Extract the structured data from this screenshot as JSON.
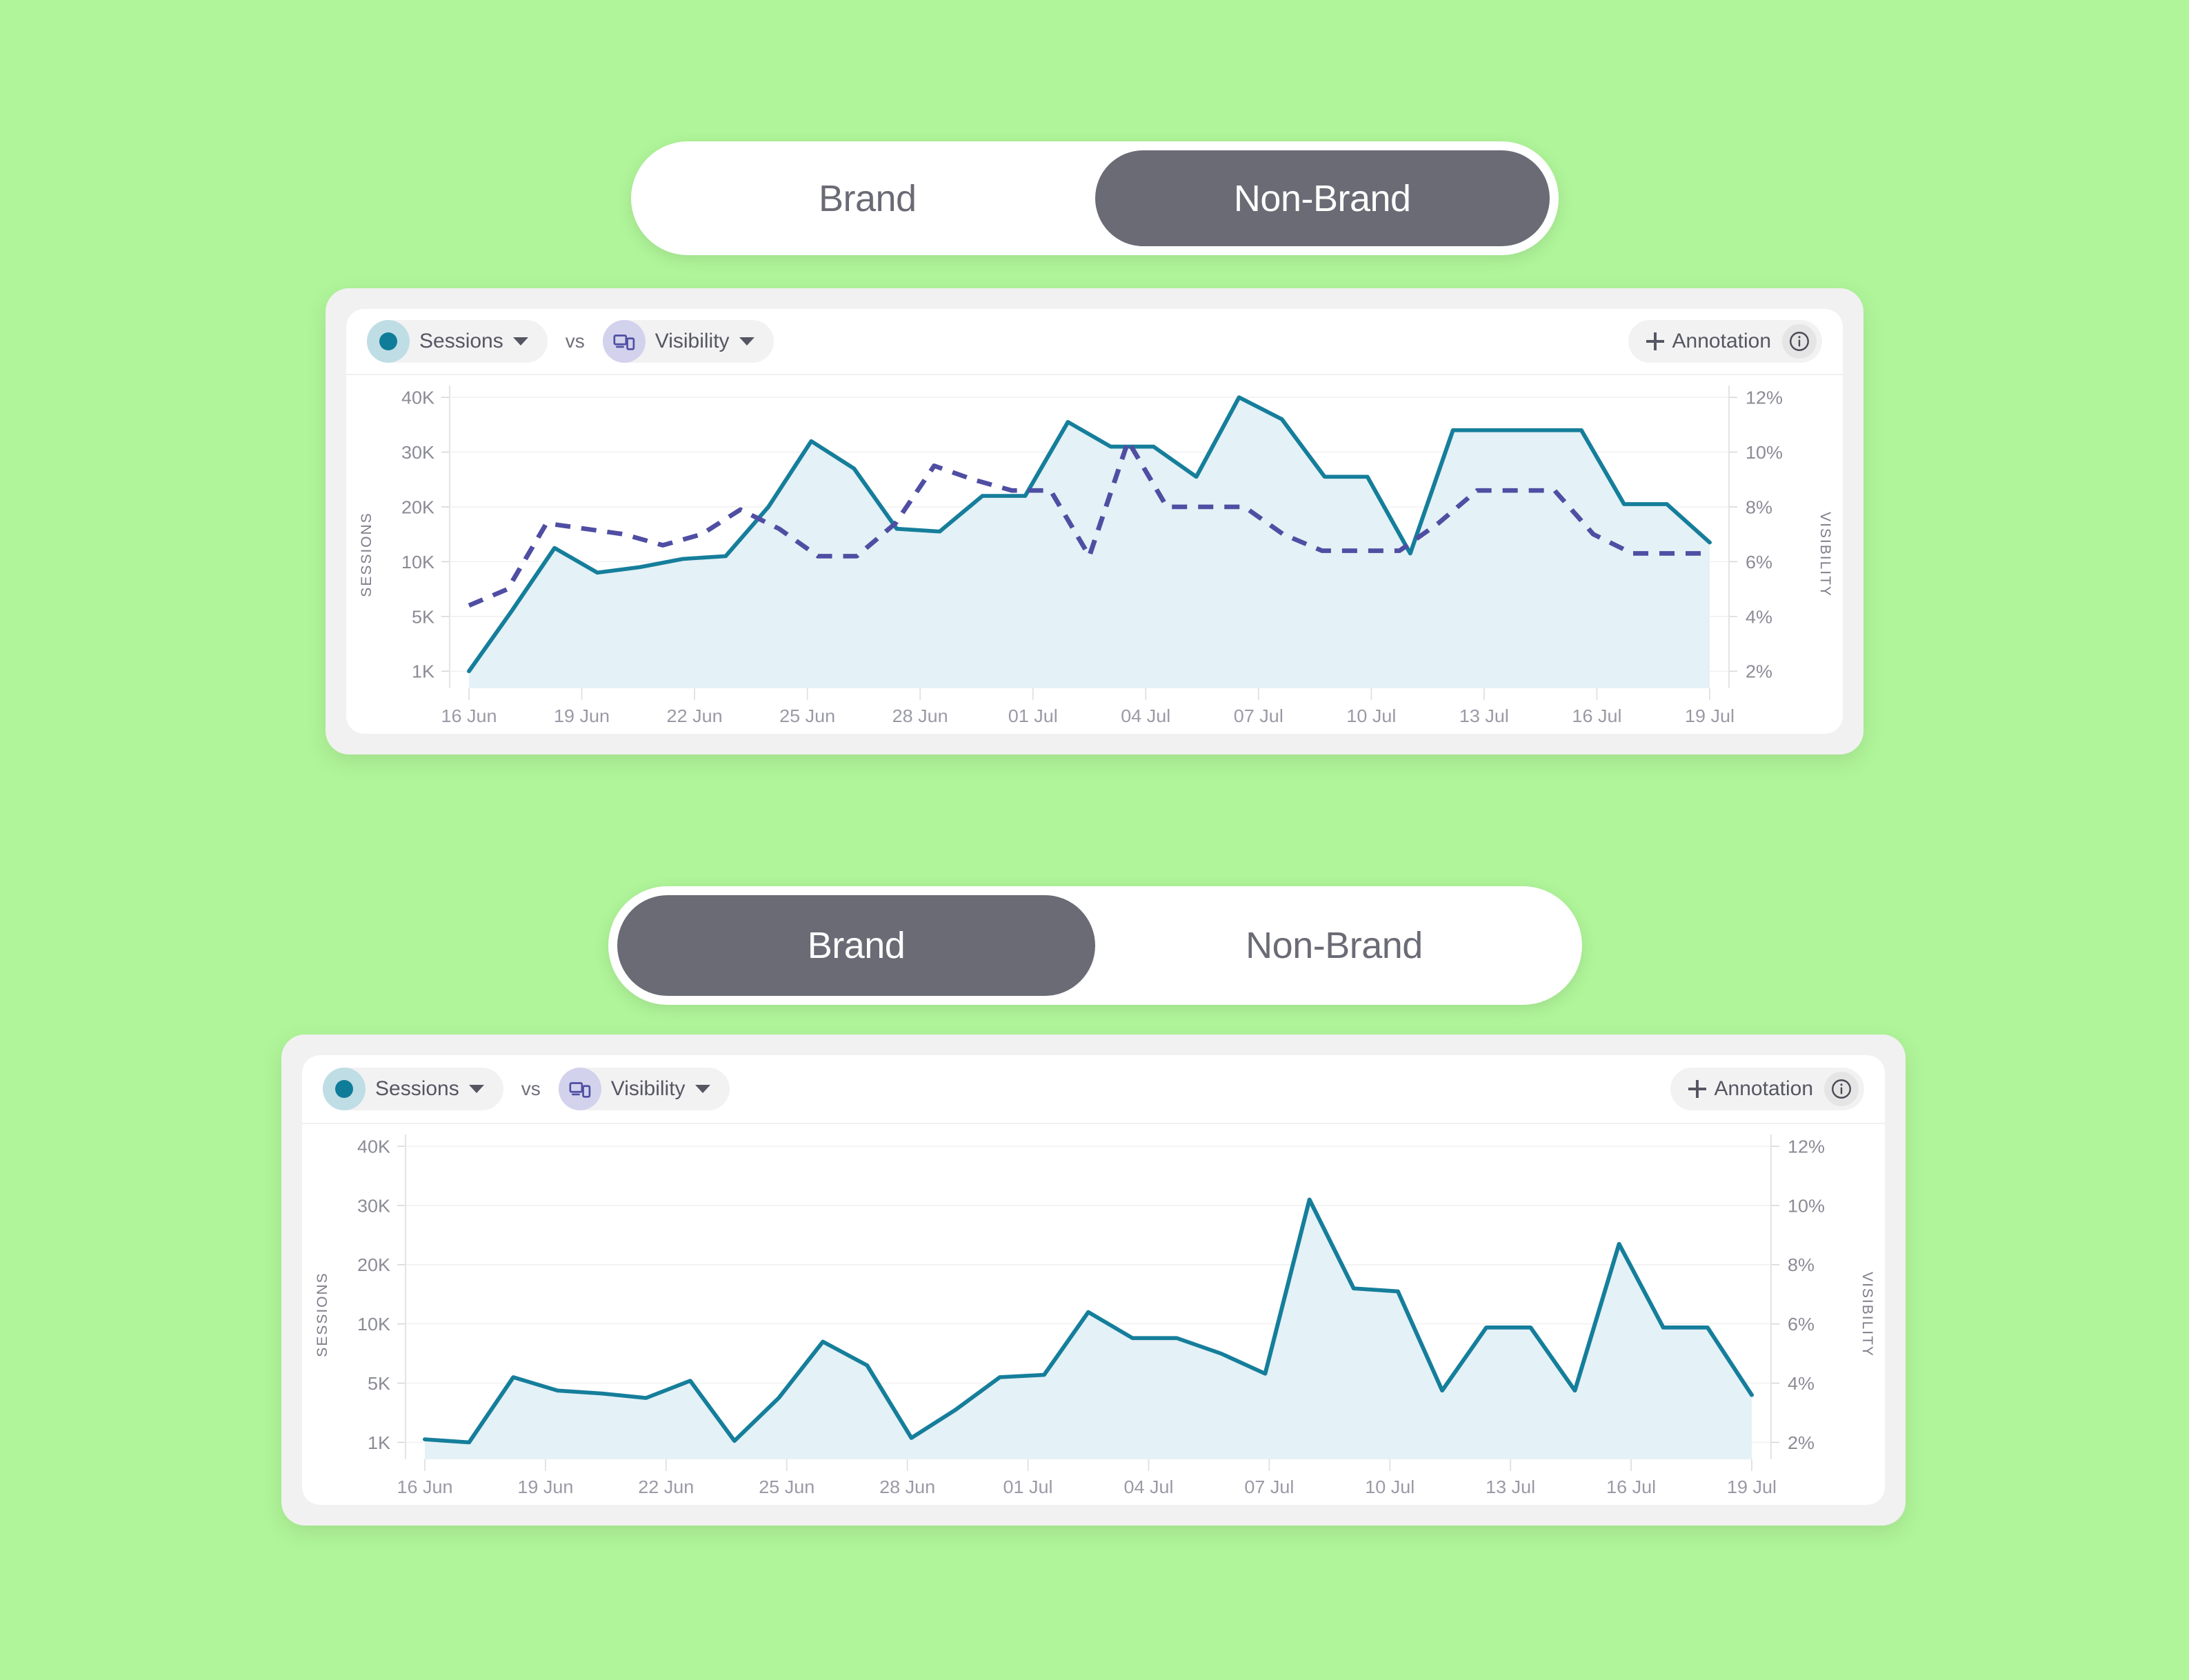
{
  "background_color": "#b0f59a",
  "accent_colors": {
    "sessions_line": "#157e9b",
    "sessions_fill": "#e4f1f6",
    "visibility_line": "#4f4ea3",
    "toggle_active_bg": "#6b6b76",
    "card_outer_bg": "#f1f1f1",
    "card_inner_bg": "#ffffff",
    "pill_bg": "#f2f2f3",
    "sessions_badge_bg": "#bfdde4",
    "visibility_badge_bg": "#d3d2ec"
  },
  "panels": [
    {
      "id": "non-brand",
      "toggle": {
        "options": [
          {
            "label": "Brand",
            "active": false
          },
          {
            "label": "Non-Brand",
            "active": true
          }
        ]
      },
      "toolbar": {
        "metric_primary": {
          "label": "Sessions",
          "icon": "circle-dot-icon"
        },
        "vs_label": "vs",
        "metric_secondary": {
          "label": "Visibility",
          "icon": "devices-icon"
        },
        "annotation_label": "Annotation",
        "annotation_plus_icon": "plus-icon",
        "info_icon": "info-circle-icon"
      }
    },
    {
      "id": "brand",
      "toggle": {
        "options": [
          {
            "label": "Brand",
            "active": true
          },
          {
            "label": "Non-Brand",
            "active": false
          }
        ]
      },
      "toolbar": {
        "metric_primary": {
          "label": "Sessions",
          "icon": "circle-dot-icon"
        },
        "vs_label": "vs",
        "metric_secondary": {
          "label": "Visibility",
          "icon": "devices-icon"
        },
        "annotation_label": "Annotation",
        "annotation_plus_icon": "plus-icon",
        "info_icon": "info-circle-icon"
      }
    }
  ],
  "chart_data": [
    {
      "id": "non-brand-chart",
      "type": "line",
      "title": "",
      "ylabel": "SESSIONS",
      "y2label": "VISIBILITY",
      "xlabel": "",
      "grid": true,
      "legend_position": "top-left",
      "x": [
        "16 Jun",
        "17 Jun",
        "18 Jun",
        "19 Jun",
        "20 Jun",
        "21 Jun",
        "22 Jun",
        "23 Jun",
        "24 Jun",
        "25 Jun",
        "26 Jun",
        "27 Jun",
        "28 Jun",
        "29 Jun",
        "30 Jun",
        "01 Jul",
        "02 Jul",
        "03 Jul",
        "04 Jul",
        "05 Jul",
        "06 Jul",
        "07 Jul",
        "08 Jul",
        "09 Jul",
        "10 Jul",
        "11 Jul",
        "12 Jul",
        "13 Jul",
        "14 Jul",
        "15 Jul",
        "16 Jul",
        "17 Jul",
        "18 Jul",
        "19 Jul",
        "20 Jul"
      ],
      "xtick_labels": [
        "16 Jun",
        "19 Jun",
        "22 Jun",
        "25 Jun",
        "28 Jun",
        "01 Jul",
        "04 Jul",
        "07 Jul",
        "10 Jul",
        "13 Jul",
        "16 Jul",
        "19 Jul"
      ],
      "yticks": [
        "1K",
        "5K",
        "10K",
        "20K",
        "30K",
        "40K"
      ],
      "ytick_values": [
        1000,
        5000,
        10000,
        20000,
        30000,
        40000
      ],
      "y2ticks": [
        "2%",
        "4%",
        "6%",
        "8%",
        "10%",
        "12%"
      ],
      "y2tick_values": [
        2,
        4,
        6,
        8,
        10,
        12
      ],
      "series": [
        {
          "name": "Sessions",
          "style": "solid-area",
          "color": "#157e9b",
          "fill": "#e4f1f6",
          "axis": "left",
          "values": [
            1000,
            5500,
            12500,
            9000,
            9500,
            10500,
            11000,
            20000,
            32000,
            27000,
            16000,
            15500,
            22000,
            22000,
            35500,
            31000,
            31000,
            25500,
            41500,
            36000,
            25500,
            25500,
            11500,
            34000,
            34000,
            34000,
            34000,
            20500,
            20500,
            13500
          ]
        },
        {
          "name": "Visibility",
          "style": "dashed",
          "color": "#4f4ea3",
          "axis": "right",
          "values": [
            4.4,
            5.0,
            7.4,
            7.2,
            7.0,
            6.6,
            7.0,
            7.9,
            7.2,
            6.2,
            6.2,
            7.4,
            9.5,
            9.0,
            8.6,
            8.6,
            6.2,
            10.4,
            8.0,
            8.0,
            8.0,
            7.0,
            6.4,
            6.4,
            6.4,
            7.4,
            8.6,
            8.6,
            8.6,
            7.0,
            6.3,
            6.3,
            6.3
          ]
        }
      ]
    },
    {
      "id": "brand-chart",
      "type": "line",
      "title": "",
      "ylabel": "SESSIONS",
      "y2label": "VISIBILITY",
      "xlabel": "",
      "grid": true,
      "legend_position": "top-left",
      "x": [
        "16 Jun",
        "17 Jun",
        "18 Jun",
        "19 Jun",
        "20 Jun",
        "21 Jun",
        "22 Jun",
        "23 Jun",
        "24 Jun",
        "25 Jun",
        "26 Jun",
        "27 Jun",
        "28 Jun",
        "29 Jun",
        "30 Jun",
        "01 Jul",
        "02 Jul",
        "03 Jul",
        "04 Jul",
        "05 Jul",
        "06 Jul",
        "07 Jul",
        "08 Jul",
        "09 Jul",
        "10 Jul",
        "11 Jul",
        "12 Jul",
        "13 Jul",
        "14 Jul",
        "15 Jul",
        "16 Jul",
        "17 Jul",
        "18 Jul",
        "19 Jul",
        "20 Jul"
      ],
      "xtick_labels": [
        "16 Jun",
        "19 Jun",
        "22 Jun",
        "25 Jun",
        "28 Jun",
        "01 Jul",
        "04 Jul",
        "07 Jul",
        "10 Jul",
        "13 Jul",
        "16 Jul",
        "19 Jul"
      ],
      "yticks": [
        "1K",
        "5K",
        "10K",
        "20K",
        "30K",
        "40K"
      ],
      "ytick_values": [
        1000,
        5000,
        10000,
        20000,
        30000,
        40000
      ],
      "y2ticks": [
        "2%",
        "4%",
        "6%",
        "8%",
        "10%",
        "12%"
      ],
      "y2tick_values": [
        2,
        4,
        6,
        8,
        10,
        12
      ],
      "series": [
        {
          "name": "Sessions",
          "style": "solid-area",
          "color": "#157e9b",
          "fill": "#e4f1f6",
          "axis": "left",
          "values": [
            1200,
            900,
            5500,
            4500,
            4300,
            4000,
            5200,
            1100,
            4000,
            8500,
            6500,
            1300,
            3200,
            5500,
            5700,
            12000,
            8800,
            8800,
            7500,
            5800,
            31000,
            16000,
            15500,
            4500,
            9700,
            9700,
            4500,
            23500,
            9700,
            9700,
            4200
          ]
        }
      ]
    }
  ]
}
